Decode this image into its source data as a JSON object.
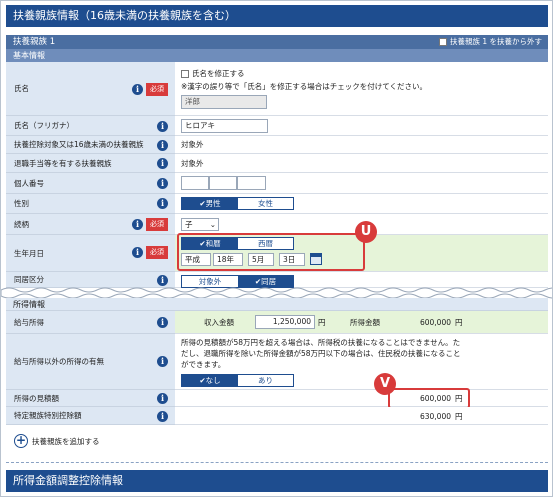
{
  "header": {
    "title": "扶養親族情報（16歳未満の扶養親族を含む）"
  },
  "dependent": {
    "title": "扶養親族 1",
    "remove_label": "扶養親族 1 を扶養から外す"
  },
  "basic": {
    "section": "基本情報",
    "name_label": "氏名",
    "required": "必須",
    "fix_name_label": "氏名を修正する",
    "fix_name_note": "※漢字の誤り等で「氏名」を修正する場合はチェックを付けてください。",
    "name_value": "洋郎",
    "kana_label": "氏名（フリガナ）",
    "kana_value": "ヒロアキ",
    "under16_label": "扶養控除対象又は16歳未満の扶養親族",
    "under16_value": "対象外",
    "retire_label": "退職手当等を有する扶養親族",
    "retire_value": "対象外",
    "mynumber_label": "個人番号",
    "gender_label": "性別",
    "gender_male": "✔男性",
    "gender_female": "女性",
    "relation_label": "続柄",
    "relation_value": "子",
    "birth_label": "生年月日",
    "era_wareki": "✔和暦",
    "era_seireki": "西暦",
    "birth_era": "平成",
    "birth_year": "18年",
    "birth_month": "5月",
    "birth_day": "3日",
    "cohabit_label": "同居区分",
    "cohabit_off": "対象外",
    "cohabit_on": "✔同居"
  },
  "income": {
    "section": "所得情報",
    "salary_label": "給与所得",
    "revenue_label": "収入金額",
    "revenue_value": "1,250,000",
    "yen": "円",
    "income_amount_label": "所得金額",
    "income_amount_value": "600,000",
    "other_label": "給与所得以外の所得の有無",
    "other_note": "所得の見積額が58万円を超える場合は、所得税の扶養になることはできません。ただし、退職所得を除いた所得金額が58万円以下の場合は、住民税の扶養になることができます。",
    "other_none": "✔なし",
    "other_yes": "あり",
    "estimate_label": "所得の見積額",
    "estimate_value": "600,000",
    "special_label": "特定親族特別控除額",
    "special_value": "630,000"
  },
  "add_dependent": "扶養親族を追加する",
  "footer": {
    "title": "所得金額調整控除情報"
  },
  "markers": {
    "u": "U",
    "v": "V"
  }
}
